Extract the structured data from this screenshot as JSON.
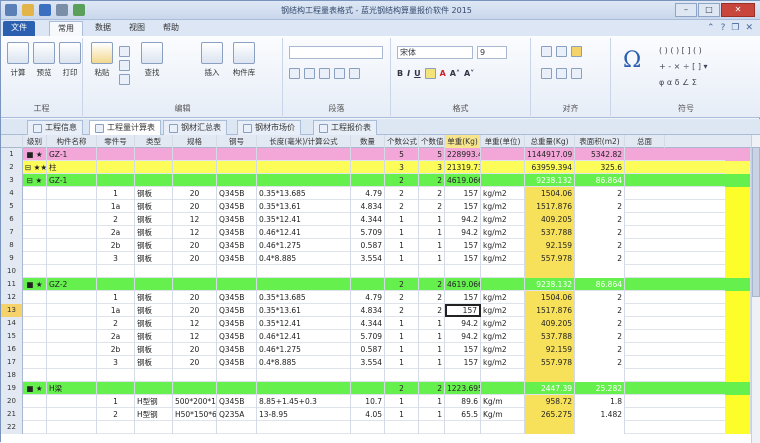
{
  "window": {
    "title": "钢结构工程量表格式 - 蓝光钢结构算量报价软件 2015"
  },
  "ribbon_tabs": [
    "文件",
    "常用",
    "数据",
    "视图",
    "帮助"
  ],
  "ribbon": {
    "groups": [
      {
        "label": "工程",
        "buttons": [
          "计算",
          "预览",
          "打印"
        ]
      },
      {
        "label": "编辑",
        "buttons": [
          "粘贴",
          "查找",
          "插入",
          "构件库"
        ]
      },
      {
        "label": "段落"
      },
      {
        "label": "格式"
      },
      {
        "label": "对齐"
      },
      {
        "label": "符号"
      }
    ],
    "font_name": "宋体",
    "font_size": "9"
  },
  "sheet_tabs": [
    "工程信息",
    "工程量计算表",
    "钢材汇总表",
    "钢材市场价",
    "工程报价表"
  ],
  "columns": [
    "级别",
    "构件名称",
    "零件号",
    "类型",
    "规格",
    "钢号",
    "长度(毫米)/计算公式",
    "数量",
    "个数公式",
    "个数值",
    "单重(Kg)",
    "单重(单位)",
    "总重量(Kg)",
    "表面积(m2)",
    "总面"
  ],
  "rows": [
    {
      "n": "1",
      "style": "pink",
      "c": [
        "■ ★",
        "GZ-1",
        "",
        "",
        "",
        "",
        "",
        "",
        "5",
        "5",
        "228993.418",
        "",
        "1144917.09",
        "5342.82"
      ]
    },
    {
      "n": "2",
      "style": "yellow",
      "c": [
        "⊟ ★★",
        "柱",
        "",
        "",
        "",
        "",
        "",
        "",
        "3",
        "3",
        "21319.738",
        "",
        "63959.394",
        "325.6"
      ]
    },
    {
      "n": "3",
      "style": "green",
      "c": [
        "⊟ ★",
        "GZ-1",
        "",
        "",
        "",
        "",
        "",
        "",
        "2",
        "2",
        "4619.066",
        "",
        "9238.132",
        "86.864"
      ]
    },
    {
      "n": "4",
      "c": [
        "",
        "",
        "1",
        "钢板",
        "20",
        "Q345B",
        "0.35*13.685",
        "4.79",
        "2",
        "2",
        "157",
        "kg/m2",
        "1504.06",
        "2"
      ]
    },
    {
      "n": "5",
      "c": [
        "",
        "",
        "1a",
        "钢板",
        "20",
        "Q345B",
        "0.35*13.61",
        "4.834",
        "2",
        "2",
        "157",
        "kg/m2",
        "1517.876",
        "2"
      ]
    },
    {
      "n": "6",
      "c": [
        "",
        "",
        "2",
        "钢板",
        "12",
        "Q345B",
        "0.35*12.41",
        "4.344",
        "1",
        "1",
        "94.2",
        "kg/m2",
        "409.205",
        "2"
      ]
    },
    {
      "n": "7",
      "c": [
        "",
        "",
        "2a",
        "钢板",
        "12",
        "Q345B",
        "0.46*12.41",
        "5.709",
        "1",
        "1",
        "94.2",
        "kg/m2",
        "537.788",
        "2"
      ]
    },
    {
      "n": "8",
      "c": [
        "",
        "",
        "2b",
        "钢板",
        "20",
        "Q345B",
        "0.46*1.275",
        "0.587",
        "1",
        "1",
        "157",
        "kg/m2",
        "92.159",
        "2"
      ]
    },
    {
      "n": "9",
      "c": [
        "",
        "",
        "3",
        "钢板",
        "20",
        "Q345B",
        "0.4*8.885",
        "3.554",
        "1",
        "1",
        "157",
        "kg/m2",
        "557.978",
        "2"
      ]
    },
    {
      "n": "10",
      "c": [
        "",
        "",
        "",
        "",
        "",
        "",
        "",
        "",
        "",
        "",
        "",
        "",
        "",
        ""
      ]
    },
    {
      "n": "11",
      "style": "green",
      "c": [
        "■ ★",
        "GZ-2",
        "",
        "",
        "",
        "",
        "",
        "",
        "2",
        "2",
        "4619.066",
        "",
        "9238.132",
        "86.864"
      ]
    },
    {
      "n": "12",
      "c": [
        "",
        "",
        "1",
        "钢板",
        "20",
        "Q345B",
        "0.35*13.685",
        "4.79",
        "2",
        "2",
        "157",
        "kg/m2",
        "1504.06",
        "2"
      ]
    },
    {
      "n": "13",
      "c": [
        "",
        "",
        "1a",
        "钢板",
        "20",
        "Q345B",
        "0.35*13.61",
        "4.834",
        "2",
        "2",
        "157",
        "kg/m2",
        "1517.876",
        "2"
      ]
    },
    {
      "n": "14",
      "c": [
        "",
        "",
        "2",
        "钢板",
        "12",
        "Q345B",
        "0.35*12.41",
        "4.344",
        "1",
        "1",
        "94.2",
        "kg/m2",
        "409.205",
        "2"
      ]
    },
    {
      "n": "15",
      "c": [
        "",
        "",
        "2a",
        "钢板",
        "12",
        "Q345B",
        "0.46*12.41",
        "5.709",
        "1",
        "1",
        "94.2",
        "kg/m2",
        "537.788",
        "2"
      ]
    },
    {
      "n": "16",
      "c": [
        "",
        "",
        "2b",
        "钢板",
        "20",
        "Q345B",
        "0.46*1.275",
        "0.587",
        "1",
        "1",
        "157",
        "kg/m2",
        "92.159",
        "2"
      ]
    },
    {
      "n": "17",
      "c": [
        "",
        "",
        "3",
        "钢板",
        "20",
        "Q345B",
        "0.4*8.885",
        "3.554",
        "1",
        "1",
        "157",
        "kg/m2",
        "557.978",
        "2"
      ]
    },
    {
      "n": "18",
      "c": [
        "",
        "",
        "",
        "",
        "",
        "",
        "",
        "",
        "",
        "",
        "",
        "",
        "",
        ""
      ]
    },
    {
      "n": "19",
      "style": "green",
      "c": [
        "■ ★",
        "H梁",
        "",
        "",
        "",
        "",
        "",
        "",
        "2",
        "2",
        "1223.695",
        "",
        "2447.39",
        "25.282"
      ]
    },
    {
      "n": "20",
      "c": [
        "",
        "",
        "1",
        "H型钢",
        "500*200*10*16",
        "Q345B",
        "8.85+1.45+0.3",
        "10.7",
        "1",
        "1",
        "89.6",
        "Kg/m",
        "958.72",
        "1.8"
      ]
    },
    {
      "n": "21",
      "c": [
        "",
        "",
        "2",
        "H型钢",
        "H50*150*6*9",
        "Q235A",
        "13-8.95",
        "4.05",
        "1",
        "1",
        "65.5",
        "Kg/m",
        "265.275",
        "1.482"
      ]
    },
    {
      "n": "22",
      "c": [
        "",
        "",
        "",
        "",
        "",
        "",
        "",
        "",
        "",
        "",
        "",
        "",
        "",
        ""
      ]
    }
  ]
}
